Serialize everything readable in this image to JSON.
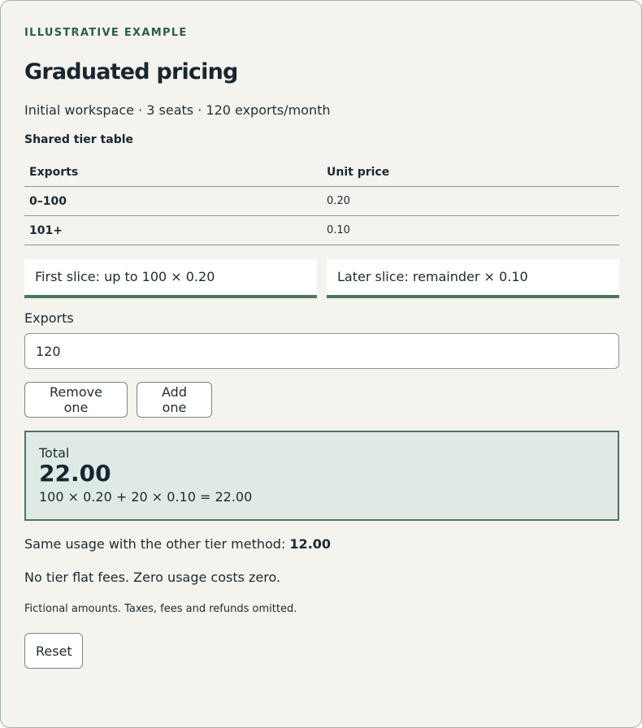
{
  "eyebrow": "ILLUSTRATIVE EXAMPLE",
  "title": "Graduated pricing",
  "subtitle": "Initial workspace · 3 seats · 120 exports/month",
  "tier_table": {
    "caption": "Shared tier table",
    "headers": [
      "Exports",
      "Unit price"
    ],
    "rows": [
      {
        "range": "0–100",
        "price": "0.20"
      },
      {
        "range": "101+",
        "price": "0.10"
      }
    ]
  },
  "slices": {
    "first": "First slice: up to 100 × 0.20",
    "later": "Later slice: remainder × 0.10"
  },
  "exports_field": {
    "label": "Exports",
    "value": "120"
  },
  "buttons": {
    "remove": "Remove one",
    "add": "Add one",
    "reset": "Reset"
  },
  "total": {
    "label": "Total",
    "value": "22.00",
    "formula": "100 × 0.20 + 20 × 0.10 = 22.00"
  },
  "comparison": {
    "text": "Same usage with the other tier method: ",
    "value": "12.00"
  },
  "note": "No tier flat fees. Zero usage costs zero.",
  "footnote": "Fictional amounts. Taxes, fees and refunds omitted.",
  "colors": {
    "accent": "#4f7466",
    "eyebrow": "#2f5d50",
    "card_background": "#f4f3ee",
    "total_background": "#e0eae5"
  }
}
